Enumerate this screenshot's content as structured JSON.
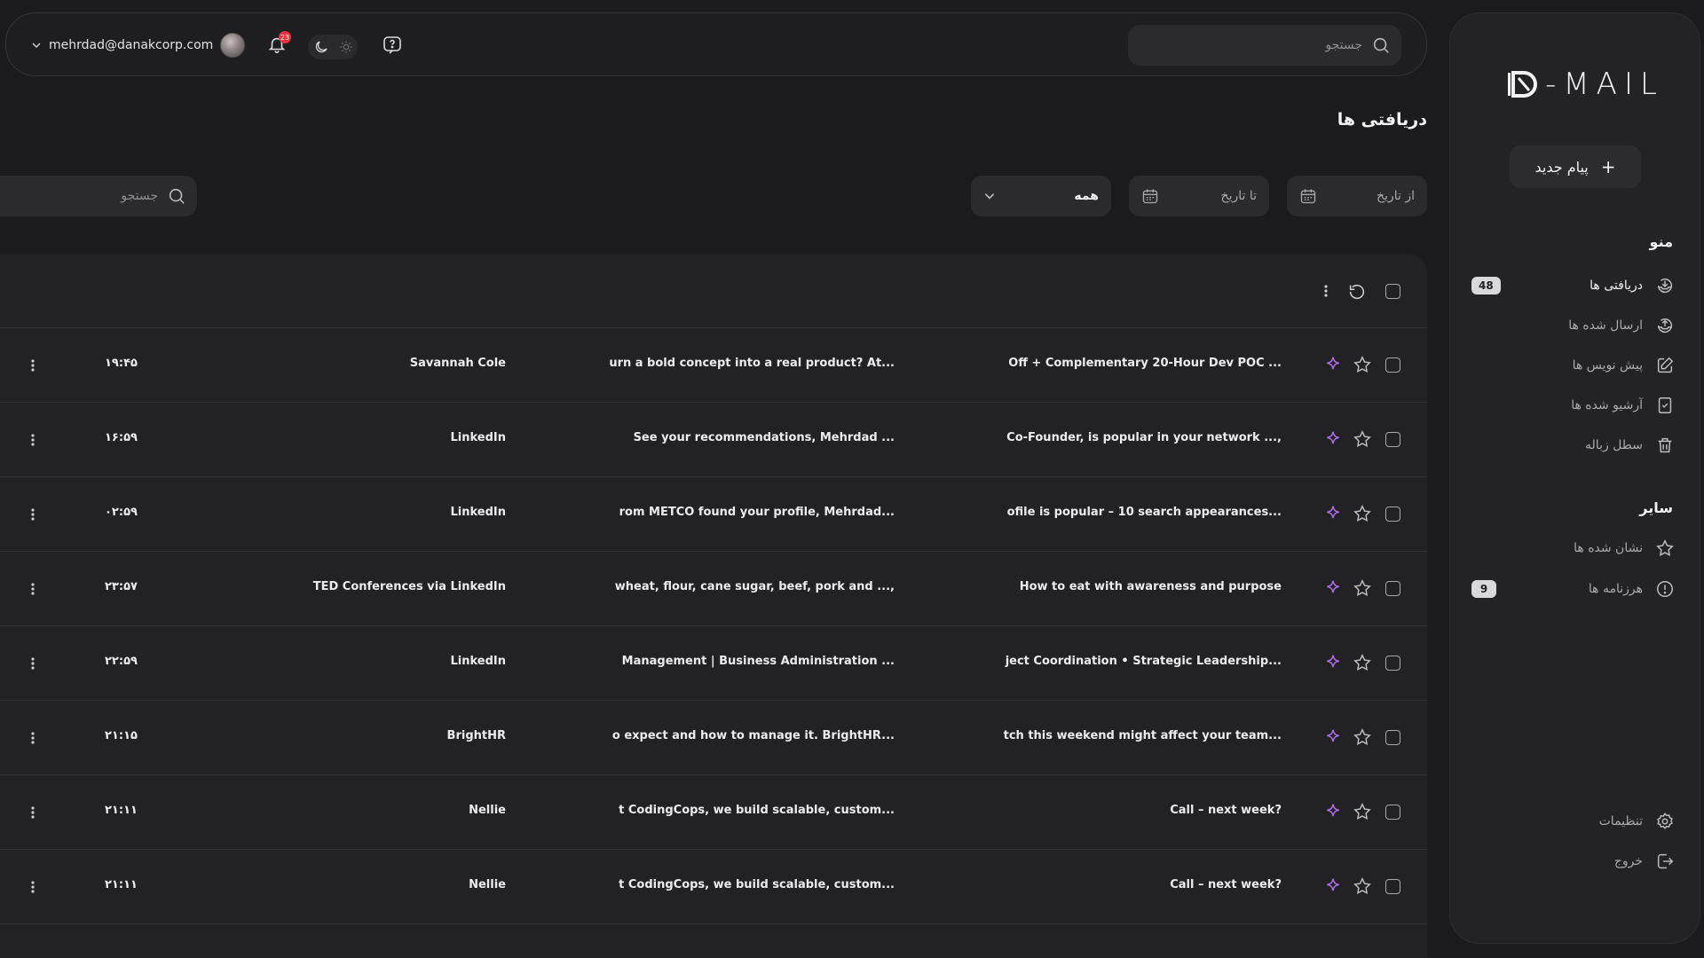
{
  "app": {
    "logo_text": "-MAIL"
  },
  "header": {
    "search_placeholder": "جستجو",
    "user_email": "mehrdad@danakcorp.com",
    "notification_count": "23"
  },
  "sidebar": {
    "new_message_label": "پیام جدید",
    "menu_heading": "منو",
    "menu_items": [
      {
        "label": "دریافتی ها",
        "badge": "48",
        "icon": "inbox-icon"
      },
      {
        "label": "ارسال شده ها",
        "badge": "",
        "icon": "sent-icon"
      },
      {
        "label": "پیش نویس ها",
        "badge": "",
        "icon": "draft-edit-icon"
      },
      {
        "label": "آرشیو شده ها",
        "badge": "",
        "icon": "archive-icon"
      },
      {
        "label": "سطل زباله",
        "badge": "",
        "icon": "trash-icon"
      }
    ],
    "other_heading": "سایر",
    "other_items": [
      {
        "label": "نشان شده ها",
        "badge": "",
        "icon": "star-icon"
      },
      {
        "label": "هرزنامه ها",
        "badge": "9",
        "icon": "spam-alert-icon"
      }
    ],
    "settings_label": "تنظیمات",
    "logout_label": "خروج"
  },
  "page": {
    "title": "دریافتی ها",
    "from_date_placeholder": "از تاریخ",
    "to_date_placeholder": "تا تاریخ",
    "filter_selected": "همه",
    "list_search_placeholder": "جستجو"
  },
  "messages": [
    {
      "subject": "Off + Complementary 20-Hour Dev POC ...",
      "snippet": "urn a bold concept into a real product? At...",
      "sender": "Savannah Cole",
      "time": "۱۹:۴۵"
    },
    {
      "subject": "Co-Founder, is popular in your network ...,",
      "snippet": "See your recommendations, Mehrdad     ...",
      "sender": "LinkedIn",
      "time": "۱۶:۵۹"
    },
    {
      "subject": "ofile is popular – 10 search appearances...",
      "snippet": "rom METCO found your profile, Mehrdad...",
      "sender": "LinkedIn",
      "time": "۰۲:۵۹"
    },
    {
      "subject": "How to eat with awareness and purpose",
      "snippet": "wheat, flour, cane sugar, beef, pork and ...,",
      "sender": "TED Conferences via LinkedIn",
      "time": "۲۳:۵۷"
    },
    {
      "subject": "ject Coordination • Strategic Leadership...",
      "snippet": "Management | Business Administration ...",
      "sender": "LinkedIn",
      "time": "۲۲:۵۹"
    },
    {
      "subject": "tch this weekend might affect your team...",
      "snippet": "o expect and how to manage it. BrightHR...",
      "sender": "BrightHR",
      "time": "۲۱:۱۵"
    },
    {
      "subject": "Call – next week?",
      "snippet": "t CodingCops, we build scalable, custom...",
      "sender": "Nellie",
      "time": "۲۱:۱۱"
    },
    {
      "subject": "Call – next week?",
      "snippet": "t CodingCops, we build scalable, custom...",
      "sender": "Nellie",
      "time": "۲۱:۱۱"
    }
  ],
  "colors": {
    "background": "#1b1b1d",
    "panel": "#222224",
    "accent_sparkle": "#b56cf0",
    "badge_notification": "#e5323f"
  }
}
